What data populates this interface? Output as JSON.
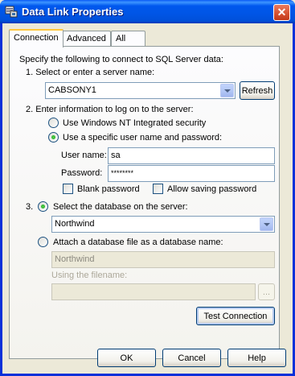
{
  "window": {
    "title": "Data Link Properties",
    "close_glyph": "✕"
  },
  "tabs": [
    {
      "label": "Connection"
    },
    {
      "label": "Advanced"
    },
    {
      "label": "All"
    }
  ],
  "connection": {
    "intro": "Specify the following to connect to SQL Server data:",
    "step1_label": "1. Select or enter a server name:",
    "server_value": "CABSONY1",
    "refresh_label": "Refresh",
    "step2_label": "2. Enter information to log on to the server:",
    "auth_nt_label": "Use Windows NT Integrated security",
    "auth_specific_label": "Use a specific user name and password:",
    "username_label": "User name:",
    "username_value": "sa",
    "password_label": "Password:",
    "password_value": "********",
    "blank_password_label": "Blank password",
    "allow_saving_label": "Allow saving password",
    "step3_number": "3.",
    "select_db_label": "Select the database on the server:",
    "database_value": "Northwind",
    "attach_label": "Attach a database file as a database name:",
    "attach_name_value": "Northwind",
    "filename_label": "Using the filename:",
    "filename_value": "",
    "browse_label": "...",
    "test_connection_label": "Test Connection"
  },
  "footer": {
    "ok_label": "OK",
    "cancel_label": "Cancel",
    "help_label": "Help"
  },
  "colors": {
    "titlebar": "#0055E5",
    "face": "#ECE9D8",
    "checked_radio": "#21A121"
  }
}
